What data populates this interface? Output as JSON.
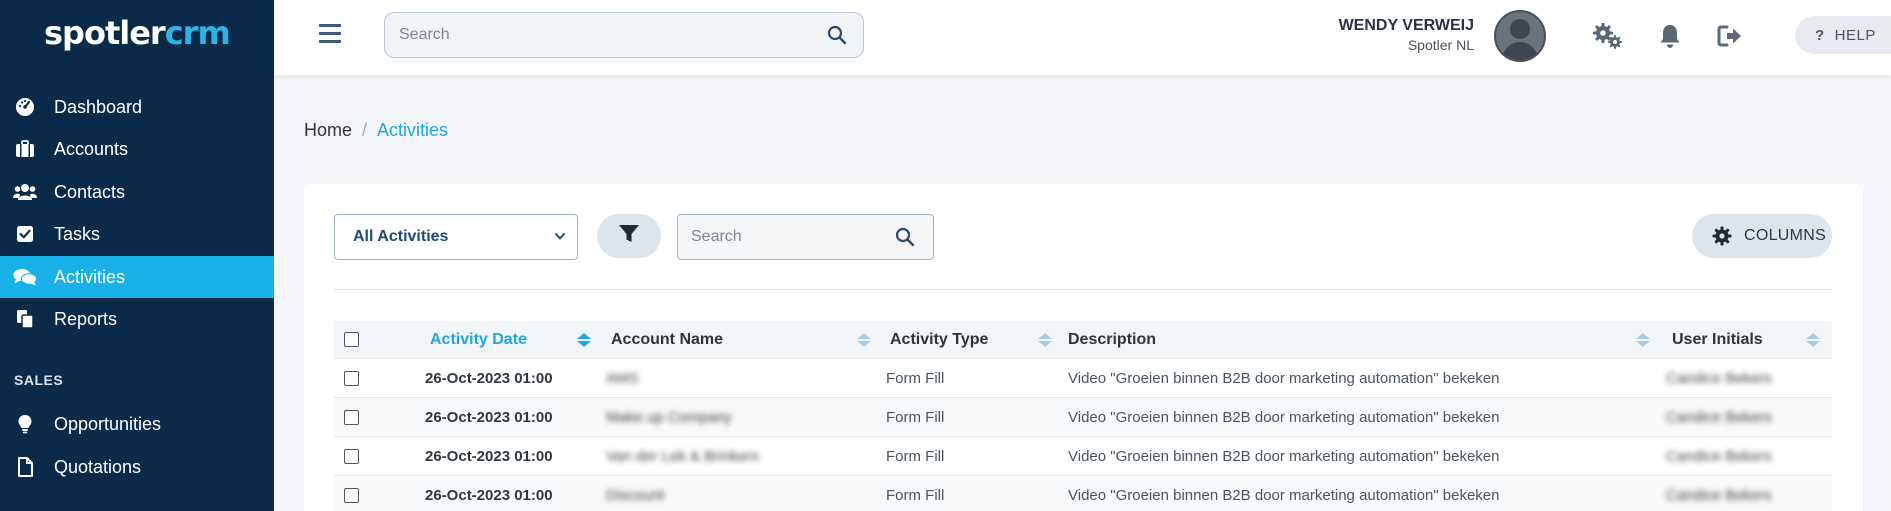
{
  "brand": {
    "part1": "spotler",
    "part2": "crm"
  },
  "sidebar": {
    "items": [
      {
        "label": "Dashboard",
        "icon": "dashboard-icon"
      },
      {
        "label": "Accounts",
        "icon": "briefcase-icon"
      },
      {
        "label": "Contacts",
        "icon": "users-icon"
      },
      {
        "label": "Tasks",
        "icon": "checkbox-icon"
      },
      {
        "label": "Activities",
        "icon": "comments-icon",
        "active": true
      },
      {
        "label": "Reports",
        "icon": "copy-icon"
      }
    ],
    "section_sales": "SALES",
    "sales_items": [
      {
        "label": "Opportunities",
        "icon": "lightbulb-icon"
      },
      {
        "label": "Quotations",
        "icon": "file-icon"
      }
    ]
  },
  "header": {
    "search_placeholder": "Search",
    "user_name": "WENDY VERWEIJ",
    "user_org": "Spotler NL",
    "help_label": "HELP"
  },
  "breadcrumb": {
    "home": "Home",
    "separator": "/",
    "current": "Activities"
  },
  "toolbar": {
    "filter_select_value": "All Activities",
    "search_placeholder": "Search",
    "columns_label": "COLUMNS"
  },
  "table": {
    "columns": [
      "Activity Date",
      "Account Name",
      "Activity Type",
      "Description",
      "User Initials"
    ],
    "rows": [
      {
        "date": "26-Oct-2023 01:00",
        "account": "AMS",
        "type": "Form Fill",
        "description": "Video \"Groeien binnen B2B door marketing automation\" bekeken",
        "initials": "Candice Bekers"
      },
      {
        "date": "26-Oct-2023 01:00",
        "account": "Make up Company",
        "type": "Form Fill",
        "description": "Video \"Groeien binnen B2B door marketing automation\" bekeken",
        "initials": "Candice Bekers"
      },
      {
        "date": "26-Oct-2023 01:00",
        "account": "Van der Lek & Brinkers",
        "type": "Form Fill",
        "description": "Video \"Groeien binnen B2B door marketing automation\" bekeken",
        "initials": "Candice Bekers"
      },
      {
        "date": "26-Oct-2023 01:00",
        "account": "Discount",
        "type": "Form Fill",
        "description": "Video \"Groeien binnen B2B door marketing automation\" bekeken",
        "initials": "Candice Bekers"
      }
    ]
  },
  "colors": {
    "sidebar_bg": "#0b2a4a",
    "accent": "#1ab0e8"
  }
}
